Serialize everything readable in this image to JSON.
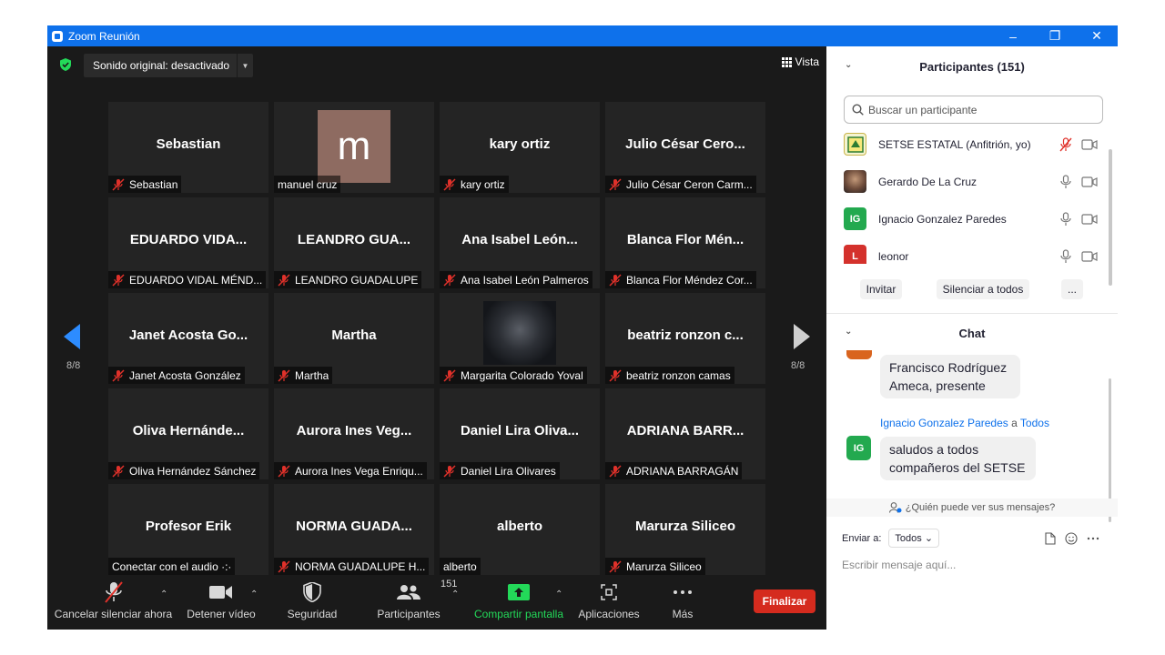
{
  "window": {
    "title": "Zoom Reunión"
  },
  "topbar": {
    "sound_label": "Sonido original: desactivado",
    "view_label": "Vista"
  },
  "grid": {
    "tiles": [
      {
        "big": "Sebastian",
        "name": "Sebastian",
        "muted": true
      },
      {
        "big": "",
        "name": "manuel cruz",
        "muted": false,
        "avatar_letter": "m"
      },
      {
        "big": "kary ortiz",
        "name": "kary ortiz",
        "muted": true
      },
      {
        "big": "Julio César Cero...",
        "name": "Julio César Ceron Carm...",
        "muted": true
      },
      {
        "big": "EDUARDO VIDA...",
        "name": "EDUARDO VIDAL MÉND...",
        "muted": true
      },
      {
        "big": "LEANDRO GUA...",
        "name": "LEANDRO GUADALUPE",
        "muted": true
      },
      {
        "big": "Ana Isabel León...",
        "name": "Ana Isabel León Palmeros",
        "muted": true
      },
      {
        "big": "Blanca Flor Mén...",
        "name": "Blanca Flor Méndez Cor...",
        "muted": true
      },
      {
        "big": "Janet Acosta Go...",
        "name": "Janet Acosta González",
        "muted": true
      },
      {
        "big": "Martha",
        "name": "Martha",
        "muted": true
      },
      {
        "big": "",
        "name": "Margarita Colorado Yoval",
        "muted": true,
        "avatar_image": "ninja-avatar"
      },
      {
        "big": "beatriz ronzon c...",
        "name": "beatriz ronzon camas",
        "muted": true
      },
      {
        "big": "Oliva Hernánde...",
        "name": "Oliva Hernández Sánchez",
        "muted": true
      },
      {
        "big": "Aurora Ines Veg...",
        "name": "Aurora Ines Vega Enriqu...",
        "muted": true
      },
      {
        "big": "Daniel Lira Oliva...",
        "name": "Daniel Lira Olivares",
        "muted": true
      },
      {
        "big": "ADRIANA BARR...",
        "name": "ADRIANA BARRAGÁN",
        "muted": true
      },
      {
        "big": "Profesor Erik",
        "name": "Conectar con el audio ·:·",
        "muted": false
      },
      {
        "big": "NORMA GUADA...",
        "name": "NORMA GUADALUPE H...",
        "muted": true
      },
      {
        "big": "alberto",
        "name": "alberto",
        "muted": false
      },
      {
        "big": "Marurza Siliceo",
        "name": "Marurza Siliceo",
        "muted": true
      }
    ],
    "page_left": "8/8",
    "page_right": "8/8"
  },
  "toolbar": {
    "unmute_label": "Cancelar silenciar ahora",
    "video_label": "Detener vídeo",
    "security_label": "Seguridad",
    "participants_label": "Participantes",
    "participants_count": "151",
    "share_label": "Compartir pantalla",
    "apps_label": "Aplicaciones",
    "more_label": "Más",
    "end_label": "Finalizar"
  },
  "participants_panel": {
    "title": "Participantes (151)",
    "search_placeholder": "Buscar un participante",
    "items": [
      {
        "name": "SETSE ESTATAL (Anfitrión, yo)",
        "avatar": "logo",
        "mic": "muted"
      },
      {
        "name": "Gerardo De La Cruz",
        "avatar": "photo",
        "mic": "on"
      },
      {
        "name": "Ignacio Gonzalez Paredes",
        "avatar": "IG",
        "avatar_color": "#23a94f",
        "mic": "on"
      },
      {
        "name": "leonor",
        "avatar": "L",
        "avatar_color": "#d4312c",
        "mic": "on"
      }
    ],
    "invite_label": "Invitar",
    "mute_all_label": "Silenciar a todos",
    "more_label": "..."
  },
  "chat_panel": {
    "title": "Chat",
    "messages": [
      {
        "text_line1": "Francisco Rodríguez",
        "text_line2": "Ameca, presente"
      },
      {
        "sender": "Ignacio Gonzalez Paredes",
        "to_word": "a",
        "recipient": "Todos",
        "avatar": "IG",
        "text_line1": "saludos a todos",
        "text_line2": "compañeros del SETSE"
      }
    ],
    "who_can_see": "¿Quién puede ver sus mensajes?",
    "send_to_label": "Enviar a:",
    "send_to_value": "Todos",
    "compose_placeholder": "Escribir mensaje aquí..."
  },
  "colors": {
    "accent": "#0e71eb",
    "end_red": "#d52b1e",
    "share_green": "#23d959",
    "tile_bg": "#242424"
  }
}
